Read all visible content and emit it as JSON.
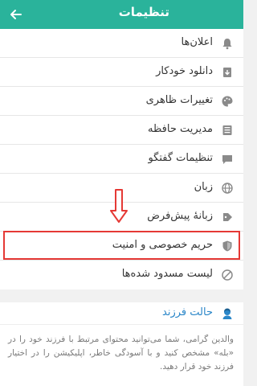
{
  "header": {
    "title": "تنظیمات",
    "back_icon": "arrow-left-icon",
    "background": "#2ab39b"
  },
  "menu": {
    "items": [
      {
        "label": "اعلان‌ها",
        "icon": "bell-icon"
      },
      {
        "label": "دانلود خودکار",
        "icon": "download-icon"
      },
      {
        "label": "تغییرات ظاهری",
        "icon": "palette-icon"
      },
      {
        "label": "مدیریت حافظه",
        "icon": "storage-icon"
      },
      {
        "label": "تنظیمات گفتگو",
        "icon": "chat-icon"
      },
      {
        "label": "زبان",
        "icon": "globe-icon"
      },
      {
        "label": "زبانهٔ پیش‌فرض",
        "icon": "tag-icon"
      },
      {
        "label": "حریم خصوصی و امنیت",
        "icon": "shield-icon"
      },
      {
        "label": "لیست مسدود شده‌ها",
        "icon": "block-icon"
      }
    ]
  },
  "kid_mode": {
    "title": "حالت فرزند",
    "icon": "kid-icon",
    "description": "والدین گرامی، شما می‌توانید محتوای مرتبط با فرزند خود را در «بله» مشخص کنید و با آسودگی خاطر، اپلیکیشن را در اختیار فرزند خود قرار دهید."
  },
  "colors": {
    "accent": "#2ab39b",
    "highlight_border": "#e53935",
    "link_blue": "#2a86c8"
  }
}
